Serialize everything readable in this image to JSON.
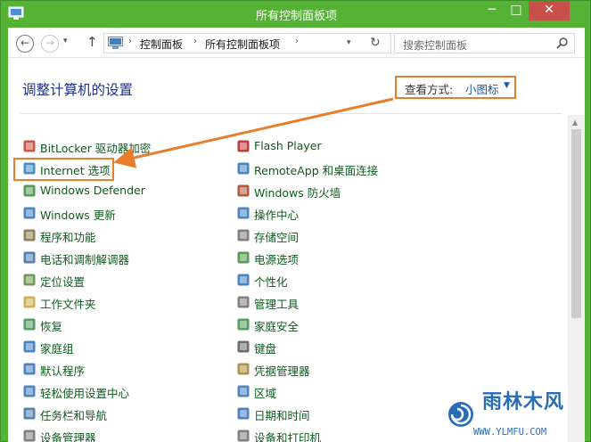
{
  "window": {
    "title": "所有控制面板项",
    "min_label": "─",
    "max_label": "□",
    "close_label": "✕",
    "frame_color": "#55b235"
  },
  "nav": {
    "back": "←",
    "forward": "→",
    "dropdown": "▾",
    "up": "↑",
    "breadcrumbs": [
      "控制面板",
      "所有控制面板项"
    ],
    "separator": "›",
    "refresh": "↻",
    "search_placeholder": "搜索控制面板"
  },
  "main": {
    "heading": "调整计算机的设置",
    "view_by_label": "查看方式:",
    "view_by_value": "小图标",
    "view_by_caret": "▼",
    "left_items": [
      {
        "label": "BitLocker 驱动器加密",
        "icon": "bitlocker-icon"
      },
      {
        "label": "Internet 选项",
        "icon": "internet-options-icon"
      },
      {
        "label": "Windows Defender",
        "icon": "defender-icon"
      },
      {
        "label": "Windows 更新",
        "icon": "windows-update-icon"
      },
      {
        "label": "程序和功能",
        "icon": "programs-icon"
      },
      {
        "label": "电话和调制解调器",
        "icon": "phone-modem-icon"
      },
      {
        "label": "定位设置",
        "icon": "location-icon"
      },
      {
        "label": "工作文件夹",
        "icon": "work-folders-icon"
      },
      {
        "label": "恢复",
        "icon": "recovery-icon"
      },
      {
        "label": "家庭组",
        "icon": "homegroup-icon"
      },
      {
        "label": "默认程序",
        "icon": "default-programs-icon"
      },
      {
        "label": "轻松使用设置中心",
        "icon": "ease-of-access-icon"
      },
      {
        "label": "任务栏和导航",
        "icon": "taskbar-icon"
      },
      {
        "label": "设备管理器",
        "icon": "device-manager-icon"
      }
    ],
    "right_items": [
      {
        "label": "Flash Player",
        "icon": "flash-icon"
      },
      {
        "label": "RemoteApp 和桌面连接",
        "icon": "remoteapp-icon"
      },
      {
        "label": "Windows 防火墙",
        "icon": "firewall-icon"
      },
      {
        "label": "操作中心",
        "icon": "action-center-icon"
      },
      {
        "label": "存储空间",
        "icon": "storage-icon"
      },
      {
        "label": "电源选项",
        "icon": "power-icon"
      },
      {
        "label": "个性化",
        "icon": "personalization-icon"
      },
      {
        "label": "管理工具",
        "icon": "admin-tools-icon"
      },
      {
        "label": "家庭安全",
        "icon": "family-safety-icon"
      },
      {
        "label": "键盘",
        "icon": "keyboard-icon"
      },
      {
        "label": "凭据管理器",
        "icon": "credential-icon"
      },
      {
        "label": "区域",
        "icon": "region-icon"
      },
      {
        "label": "日期和时间",
        "icon": "datetime-icon"
      },
      {
        "label": "设备和打印机",
        "icon": "devices-printers-icon"
      }
    ],
    "highlight_color": "#e87e2b"
  },
  "watermark": {
    "title": "雨林木风",
    "url": "WWW.YLMFU.COM"
  }
}
